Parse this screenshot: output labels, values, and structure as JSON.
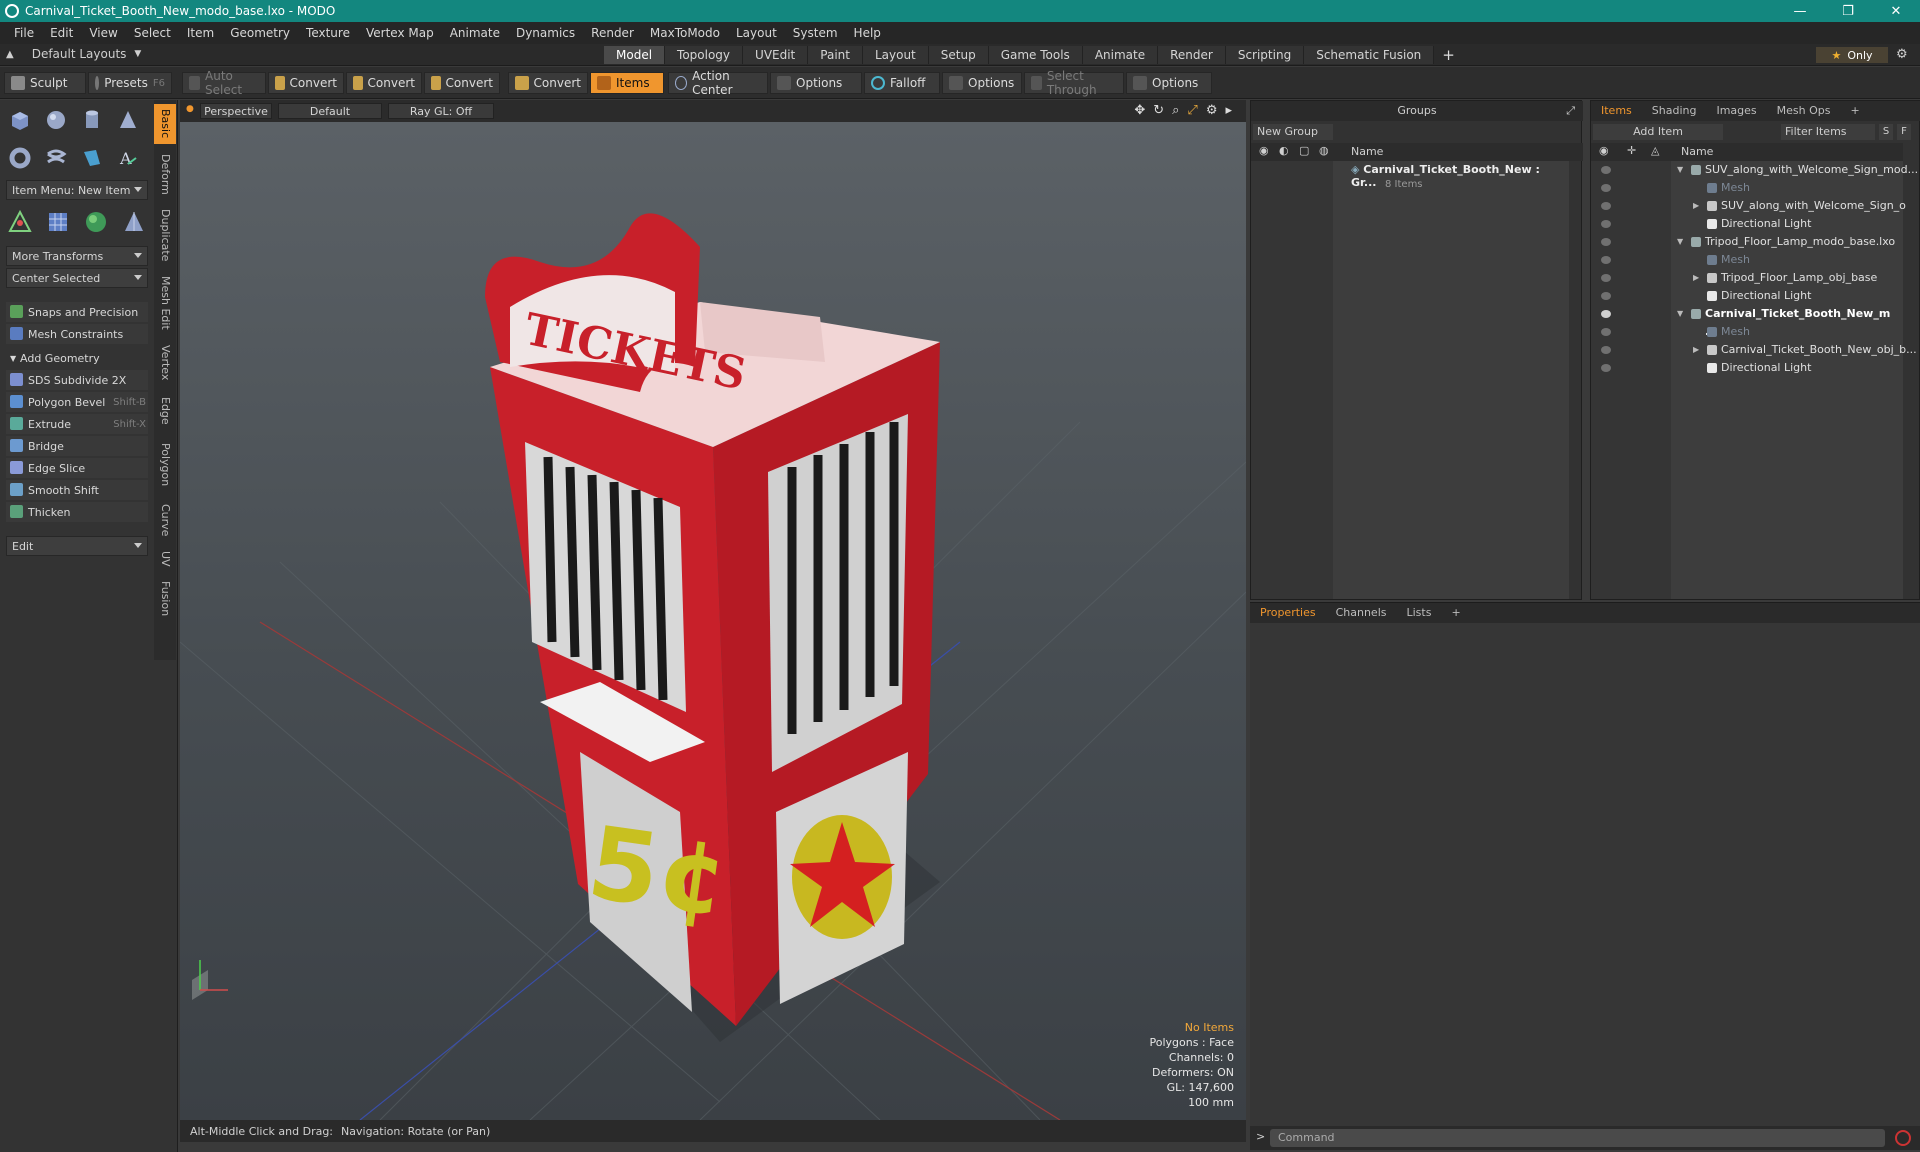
{
  "window": {
    "title": "Carnival_Ticket_Booth_New_modo_base.lxo - MODO",
    "minimize": "—",
    "restore": "❐",
    "close": "✕"
  },
  "menu": [
    "File",
    "Edit",
    "View",
    "Select",
    "Item",
    "Geometry",
    "Texture",
    "Vertex Map",
    "Animate",
    "Dynamics",
    "Render",
    "MaxToModo",
    "Layout",
    "System",
    "Help"
  ],
  "layout": {
    "default_layouts": "Default Layouts",
    "tabs": [
      "Model",
      "Topology",
      "UVEdit",
      "Paint",
      "Layout",
      "Setup",
      "Game Tools",
      "Animate",
      "Render",
      "Scripting",
      "Schematic Fusion"
    ],
    "active_tab": "Model",
    "plus": "+",
    "only_label": "Only",
    "only_star": "★"
  },
  "toolbar": {
    "sculpt": "Sculpt",
    "presets": "Presets",
    "presets_key": "F6",
    "auto_select": "Auto Select",
    "convert1": "Convert",
    "convert2": "Convert",
    "convert3": "Convert",
    "convert4": "Convert",
    "items": "Items",
    "action_center": "Action Center",
    "options1": "Options",
    "falloff": "Falloff",
    "options2": "Options",
    "select_through": "Select Through",
    "options3": "Options"
  },
  "left": {
    "vtabs": [
      "Basic",
      "Deform",
      "Duplicate",
      "Mesh Edit",
      "Vertex",
      "Edge",
      "Polygon",
      "Curve",
      "UV",
      "Fusion"
    ],
    "item_menu": "Item Menu: New Item",
    "more_transforms": "More Transforms",
    "center_selected": "Center Selected",
    "snaps": "Snaps and Precision",
    "mesh_constraints": "Mesh Constraints",
    "add_geometry": "Add Geometry",
    "tools": [
      {
        "label": "SDS Subdivide 2X",
        "shortcut": ""
      },
      {
        "label": "Polygon Bevel",
        "shortcut": "Shift-B"
      },
      {
        "label": "Extrude",
        "shortcut": "Shift-X"
      },
      {
        "label": "Bridge",
        "shortcut": ""
      },
      {
        "label": "Edge Slice",
        "shortcut": ""
      },
      {
        "label": "Smooth Shift",
        "shortcut": ""
      },
      {
        "label": "Thicken",
        "shortcut": ""
      }
    ],
    "edit": "Edit"
  },
  "viewport": {
    "perspective": "Perspective",
    "default": "Default",
    "raygl": "Ray GL: Off",
    "stats": {
      "no_items": "No Items",
      "polygons": "Polygons : Face",
      "channels": "Channels: 0",
      "deformers": "Deformers: ON",
      "gl": "GL: 147,600",
      "scale": "100 mm"
    },
    "sign": "TICKETS",
    "price": "5¢"
  },
  "status": {
    "hint": "Alt-Middle Click and Drag:",
    "action": "Navigation: Rotate (or Pan)"
  },
  "groups": {
    "title": "Groups",
    "new_group": "New Group",
    "name_col": "Name",
    "entry": "Carnival_Ticket_Booth_New : Gr...",
    "count": "8 Items"
  },
  "items_panel": {
    "tabs": [
      "Items",
      "Shading",
      "Images",
      "Mesh Ops"
    ],
    "plus": "+",
    "add_item": "Add Item",
    "filter": "Filter Items",
    "s_btn": "S",
    "f_btn": "F",
    "name_col": "Name",
    "rows": [
      {
        "label": "SUV_along_with_Welcome_Sign_mod...",
        "indent": 0,
        "kind": "scene",
        "bold": false
      },
      {
        "label": "Mesh",
        "indent": 1,
        "kind": "mesh",
        "bold": false
      },
      {
        "label": "SUV_along_with_Welcome_Sign_o ...",
        "indent": 1,
        "kind": "group",
        "bold": false
      },
      {
        "label": "Directional Light",
        "indent": 1,
        "kind": "light",
        "bold": false
      },
      {
        "label": "Tripod_Floor_Lamp_modo_base.lxo",
        "indent": 0,
        "kind": "scene",
        "bold": false
      },
      {
        "label": "Mesh",
        "indent": 1,
        "kind": "mesh",
        "bold": false
      },
      {
        "label": "Tripod_Floor_Lamp_obj_base",
        "indent": 1,
        "kind": "group",
        "bold": false
      },
      {
        "label": "Directional Light",
        "indent": 1,
        "kind": "light",
        "bold": false
      },
      {
        "label": "Carnival_Ticket_Booth_New_m ...",
        "indent": 0,
        "kind": "scene",
        "bold": true
      },
      {
        "label": "Mesh",
        "indent": 1,
        "kind": "mesh",
        "bold": false
      },
      {
        "label": "Carnival_Ticket_Booth_New_obj_b...",
        "indent": 1,
        "kind": "group",
        "bold": false
      },
      {
        "label": "Directional Light",
        "indent": 1,
        "kind": "light",
        "bold": false
      }
    ]
  },
  "properties": {
    "tabs": [
      "Properties",
      "Channels",
      "Lists"
    ],
    "plus": "+"
  },
  "command": {
    "placeholder": "Command",
    "arrow": ">"
  },
  "colors": {
    "accent": "#f0962e",
    "title_bar": "#13877f",
    "booth_red": "#c8202a"
  }
}
